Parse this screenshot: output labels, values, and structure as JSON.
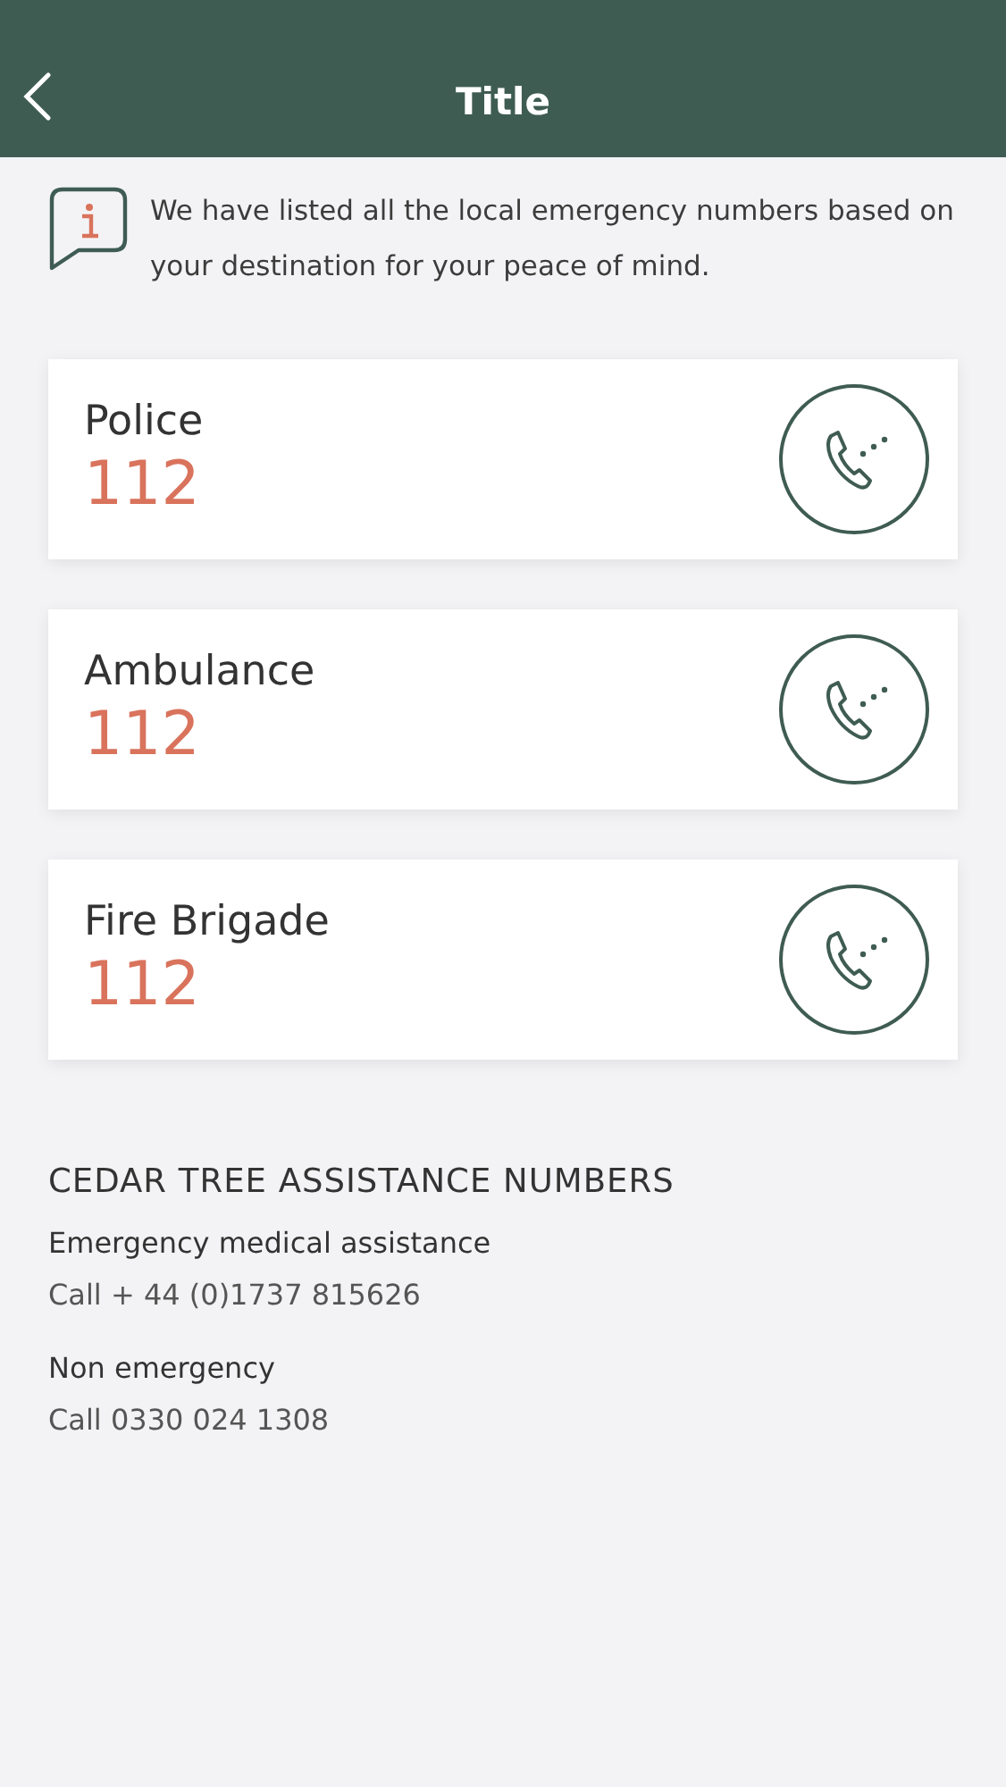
{
  "header": {
    "title": "Title"
  },
  "info": {
    "text": "We have listed all the local emergency numbers based on your destination for your peace of mind."
  },
  "services": [
    {
      "name": "Police",
      "number": "112"
    },
    {
      "name": "Ambulance",
      "number": "112"
    },
    {
      "name": "Fire Brigade",
      "number": "112"
    }
  ],
  "assistance": {
    "heading": "CEDAR TREE ASSISTANCE NUMBERS",
    "entries": [
      {
        "label": "Emergency medical assistance",
        "phone": "Call + 44 (0)1737 815626"
      },
      {
        "label": "Non emergency",
        "phone": "Call 0330 024 1308"
      }
    ]
  }
}
